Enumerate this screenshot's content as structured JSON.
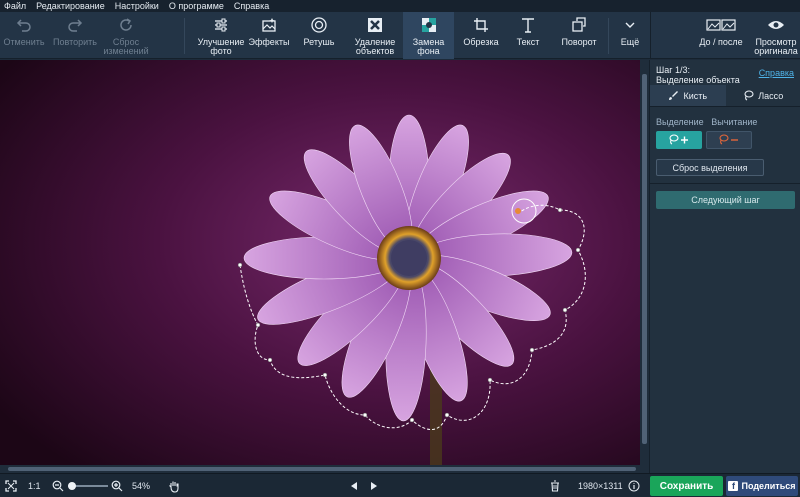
{
  "menu": [
    "Файл",
    "Редактирование",
    "Настройки",
    "О программе",
    "Справка"
  ],
  "toolbar": {
    "undo": "Отменить",
    "redo": "Повторить",
    "reset": "Сброс изменений",
    "tools": [
      {
        "icon": "sliders-icon",
        "label": "Улучшение фото"
      },
      {
        "icon": "effects-icon",
        "label": "Эффекты"
      },
      {
        "icon": "retouch-icon",
        "label": "Ретушь"
      },
      {
        "icon": "object-removal-icon",
        "label": "Удаление объектов"
      },
      {
        "icon": "background-replace-icon",
        "label": "Замена фона"
      },
      {
        "icon": "crop-icon",
        "label": "Обрезка"
      },
      {
        "icon": "text-icon",
        "label": "Текст"
      },
      {
        "icon": "rotate-icon",
        "label": "Поворот"
      },
      {
        "icon": "chevron-down-icon",
        "label": "Ещё"
      }
    ],
    "before_after": "До / после",
    "view_original": "Просмотр оригинала"
  },
  "panel": {
    "step": "Шаг 1/3:",
    "step_title": "Выделение объекта",
    "help": "Справка",
    "tab_brush": "Кисть",
    "tab_lasso": "Лассо",
    "label_select": "Выделение",
    "label_subtract": "Вычитание",
    "reset_selection": "Сброс выделения",
    "next_step": "Следующий шаг"
  },
  "status": {
    "fit": "1:1",
    "zoom": "54%",
    "dimensions": "1980×1311",
    "save": "Сохранить",
    "share": "Поделиться"
  },
  "colors": {
    "accent_teal": "#27a3a0",
    "save_green": "#1aa55a",
    "share_blue": "#2f4a7a"
  }
}
